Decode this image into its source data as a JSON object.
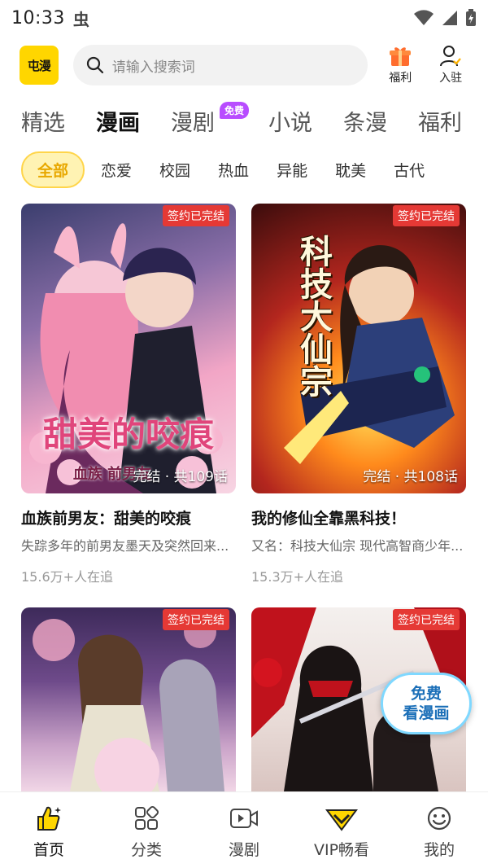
{
  "status": {
    "time": "10:33",
    "app_glyph": "虫"
  },
  "header": {
    "logo_text": "屯漫",
    "search_placeholder": "请输入搜索词",
    "gift_label": "福利",
    "join_label": "入驻"
  },
  "main_tabs": [
    {
      "label": "精选"
    },
    {
      "label": "漫画"
    },
    {
      "label": "漫剧",
      "badge": "免费"
    },
    {
      "label": "小说"
    },
    {
      "label": "条漫"
    },
    {
      "label": "福利"
    }
  ],
  "chips": [
    "全部",
    "恋爱",
    "校园",
    "热血",
    "异能",
    "耽美",
    "古代"
  ],
  "cards": [
    {
      "tag": "签约已完结",
      "episodes": "完结 · 共109话",
      "art_title": "甜美的咬痕",
      "art_sub": "血族 前男友",
      "title": "血族前男友：甜美的咬痕",
      "desc": "失踪多年的前男友墨天及突然回来...",
      "followers": "15.6万+人在追"
    },
    {
      "tag": "签约已完结",
      "episodes": "完结 · 共108话",
      "art_title": "科技大仙宗",
      "title": "我的修仙全靠黑科技！",
      "desc": "又名：科技大仙宗 现代高智商少年...",
      "followers": "15.3万+人在追"
    },
    {
      "tag": "签约已完结"
    },
    {
      "tag": "签约已完结"
    }
  ],
  "promo": {
    "line1": "免费",
    "line2": "看漫画"
  },
  "bottom_nav": [
    {
      "label": "首页",
      "icon": "home-icon"
    },
    {
      "label": "分类",
      "icon": "category-icon"
    },
    {
      "label": "漫剧",
      "icon": "video-icon"
    },
    {
      "label": "VIP畅看",
      "icon": "vip-icon"
    },
    {
      "label": "我的",
      "icon": "profile-icon"
    }
  ],
  "colors": {
    "accent": "#ffd600",
    "tag_red": "#e53935",
    "badge_purple": "#b84cff"
  }
}
